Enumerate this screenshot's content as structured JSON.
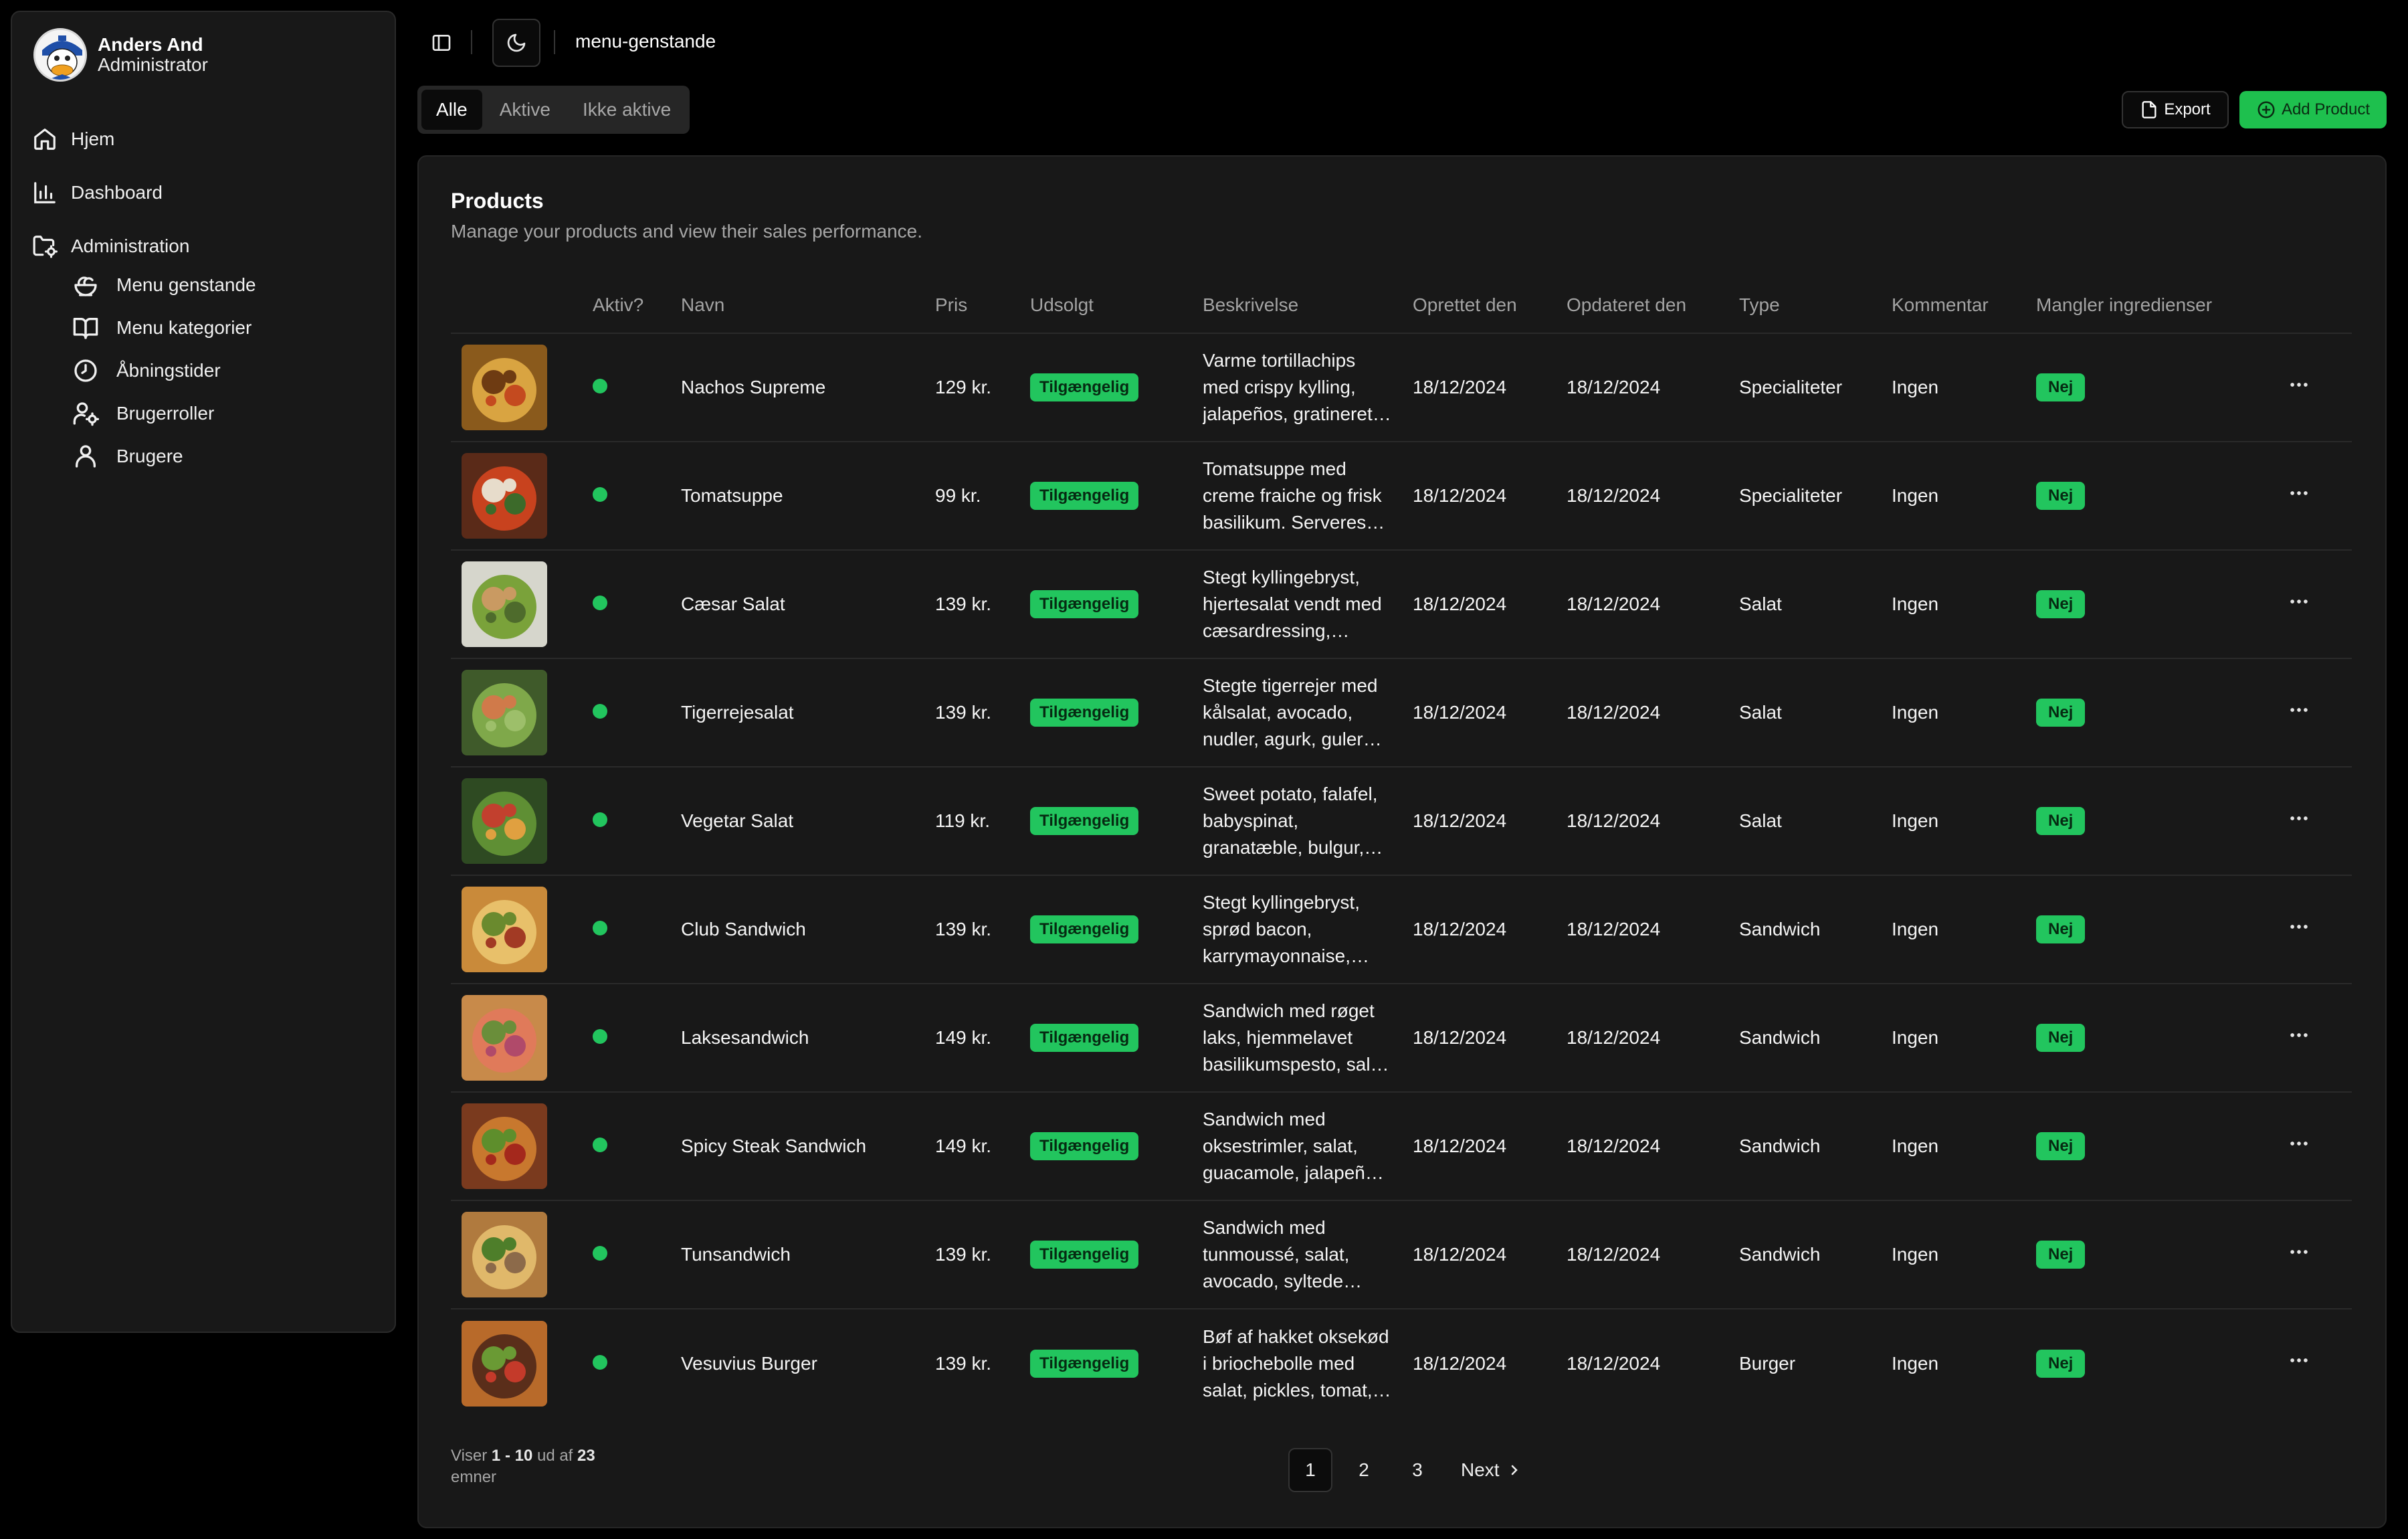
{
  "user": {
    "name": "Anders And",
    "role": "Administrator"
  },
  "nav": {
    "items": [
      {
        "label": "Hjem",
        "icon": "home-icon"
      },
      {
        "label": "Dashboard",
        "icon": "bar-chart-icon"
      },
      {
        "label": "Administration",
        "icon": "folder-cog-icon"
      }
    ],
    "sub_items": [
      {
        "label": "Menu genstande",
        "icon": "salad-icon"
      },
      {
        "label": "Menu kategorier",
        "icon": "book-open-icon"
      },
      {
        "label": "Åbningstider",
        "icon": "clock-icon"
      },
      {
        "label": "Brugerroller",
        "icon": "user-cog-icon"
      },
      {
        "label": "Brugere",
        "icon": "user-icon"
      }
    ]
  },
  "topbar": {
    "breadcrumb": "menu-genstande",
    "sidebar_toggle_icon": "panel-left-icon",
    "theme_icon": "moon-icon"
  },
  "tabs": [
    "Alle",
    "Aktive",
    "Ikke aktive"
  ],
  "actions": {
    "export": "Export",
    "add": "Add Product"
  },
  "card": {
    "title": "Products",
    "subtitle": "Manage your products and view their sales performance."
  },
  "columns": [
    "Aktiv?",
    "Navn",
    "Pris",
    "Udsolgt",
    "Beskrivelse",
    "Oprettet den",
    "Opdateret den",
    "Type",
    "Kommentar",
    "Mangler ingredienser"
  ],
  "products": [
    {
      "name": "Nachos Supreme",
      "price": "129 kr.",
      "status": "Tilgængelig",
      "desc": [
        "Varme tortillachips",
        "med crispy kylling,",
        "jalapeños, gratineret…"
      ],
      "created": "18/12/2024",
      "updated": "18/12/2024",
      "type": "Specialiteter",
      "comment": "Ingen",
      "missing": "Nej",
      "palette": [
        "#8a5a1c",
        "#d9a441",
        "#6e3b12",
        "#c44a1f"
      ]
    },
    {
      "name": "Tomatsuppe",
      "price": "99 kr.",
      "status": "Tilgængelig",
      "desc": [
        "Tomatsuppe med",
        "creme fraiche og frisk",
        "basilikum. Serveres…"
      ],
      "created": "18/12/2024",
      "updated": "18/12/2024",
      "type": "Specialiteter",
      "comment": "Ingen",
      "missing": "Nej",
      "palette": [
        "#5a2a18",
        "#c8421e",
        "#e7dccb",
        "#3c6a2a"
      ]
    },
    {
      "name": "Cæsar Salat",
      "price": "139 kr.",
      "status": "Tilgængelig",
      "desc": [
        "Stegt kyllingebryst,",
        "hjertesalat vendt med",
        "cæsardressing,…"
      ],
      "created": "18/12/2024",
      "updated": "18/12/2024",
      "type": "Salat",
      "comment": "Ingen",
      "missing": "Nej",
      "palette": [
        "#d6d6cc",
        "#7aa23a",
        "#c99a62",
        "#4e6b2c"
      ]
    },
    {
      "name": "Tigerrejesalat",
      "price": "139 kr.",
      "status": "Tilgængelig",
      "desc": [
        "Stegte tigerrejer med",
        "kålsalat, avocado,",
        "nudler, agurk, guler…"
      ],
      "created": "18/12/2024",
      "updated": "18/12/2024",
      "type": "Salat",
      "comment": "Ingen",
      "missing": "Nej",
      "palette": [
        "#3f5a2a",
        "#7fa84a",
        "#d07a4a",
        "#9dbf6a"
      ]
    },
    {
      "name": "Vegetar Salat",
      "price": "119 kr.",
      "status": "Tilgængelig",
      "desc": [
        "Sweet potato, falafel,",
        "babyspinat,",
        "granatæble, bulgur,…"
      ],
      "created": "18/12/2024",
      "updated": "18/12/2024",
      "type": "Salat",
      "comment": "Ingen",
      "missing": "Nej",
      "palette": [
        "#2e4a22",
        "#5f8f34",
        "#c2402e",
        "#e0a040"
      ]
    },
    {
      "name": "Club Sandwich",
      "price": "139 kr.",
      "status": "Tilgængelig",
      "desc": [
        "Stegt kyllingebryst,",
        "sprød bacon,",
        "karrymayonnaise,…"
      ],
      "created": "18/12/2024",
      "updated": "18/12/2024",
      "type": "Sandwich",
      "comment": "Ingen",
      "missing": "Nej",
      "palette": [
        "#c98a3a",
        "#e8c06a",
        "#6a8a2e",
        "#a23a24"
      ]
    },
    {
      "name": "Laksesandwich",
      "price": "149 kr.",
      "status": "Tilgængelig",
      "desc": [
        "Sandwich med røget",
        "laks, hjemmelavet",
        "basilikumspesto, sal…"
      ],
      "created": "18/12/2024",
      "updated": "18/12/2024",
      "type": "Sandwich",
      "comment": "Ingen",
      "missing": "Nej",
      "palette": [
        "#c88a4a",
        "#e07a5a",
        "#6a8e3a",
        "#b04a6a"
      ]
    },
    {
      "name": "Spicy Steak Sandwich",
      "price": "149 kr.",
      "status": "Tilgængelig",
      "desc": [
        "Sandwich med",
        "oksestrimler, salat,",
        "guacamole, jalapeñ…"
      ],
      "created": "18/12/2024",
      "updated": "18/12/2024",
      "type": "Sandwich",
      "comment": "Ingen",
      "missing": "Nej",
      "palette": [
        "#7a3a1e",
        "#c8782e",
        "#5e8e2c",
        "#a4281c"
      ]
    },
    {
      "name": "Tunsandwich",
      "price": "139 kr.",
      "status": "Tilgængelig",
      "desc": [
        "Sandwich med",
        "tunmoussé, salat,",
        "avocado, syltede…"
      ],
      "created": "18/12/2024",
      "updated": "18/12/2024",
      "type": "Sandwich",
      "comment": "Ingen",
      "missing": "Nej",
      "palette": [
        "#b07a3e",
        "#e0b86a",
        "#4e7e2a",
        "#8c6a4a"
      ]
    },
    {
      "name": "Vesuvius Burger",
      "price": "139 kr.",
      "status": "Tilgængelig",
      "desc": [
        "Bøf af hakket oksekød",
        "i briochebolle med",
        "salat, pickles, tomat,…"
      ],
      "created": "18/12/2024",
      "updated": "18/12/2024",
      "type": "Burger",
      "comment": "Ingen",
      "missing": "Nej",
      "palette": [
        "#b86a2a",
        "#5a2e1a",
        "#6a9a34",
        "#c43a2a"
      ]
    }
  ],
  "footer": {
    "prefix": "Viser",
    "range": "1 - 10",
    "middle": "ud af",
    "total": "23",
    "suffix": "emner"
  },
  "pagination": {
    "pages": [
      "1",
      "2",
      "3"
    ],
    "current": "1",
    "next": "Next"
  },
  "colors": {
    "accent": "#22c55e",
    "background": "#000000",
    "card": "#181818"
  }
}
